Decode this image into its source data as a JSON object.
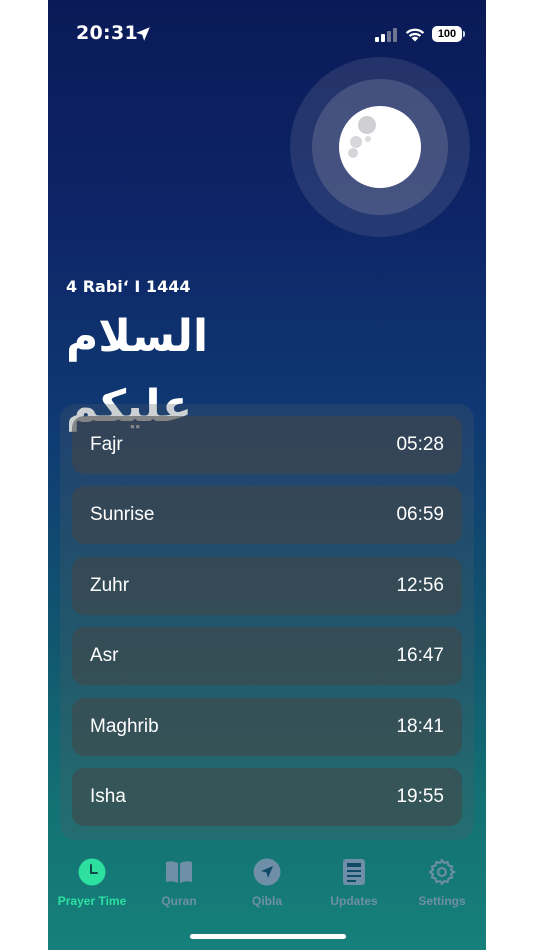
{
  "status_bar": {
    "time": "20:31",
    "battery": "100"
  },
  "header": {
    "hijri_date": "4 Rabiʻ I 1444",
    "greeting": "السلام عليكم"
  },
  "prayers": [
    {
      "name": "Fajr",
      "time": "05:28"
    },
    {
      "name": "Sunrise",
      "time": "06:59"
    },
    {
      "name": "Zuhr",
      "time": "12:56"
    },
    {
      "name": "Asr",
      "time": "16:47"
    },
    {
      "name": "Maghrib",
      "time": "18:41"
    },
    {
      "name": "Isha",
      "time": "19:55"
    }
  ],
  "tabs": [
    {
      "label": "Prayer Time",
      "icon": "clock-icon",
      "active": true
    },
    {
      "label": "Quran",
      "icon": "book-icon",
      "active": false
    },
    {
      "label": "Qibla",
      "icon": "compass-icon",
      "active": false
    },
    {
      "label": "Updates",
      "icon": "newspaper-icon",
      "active": false
    },
    {
      "label": "Settings",
      "icon": "gear-icon",
      "active": false
    }
  ],
  "colors": {
    "accent": "#2ee0a0",
    "tab_inactive": "#6f8ea8",
    "moon": "#ffffff"
  }
}
